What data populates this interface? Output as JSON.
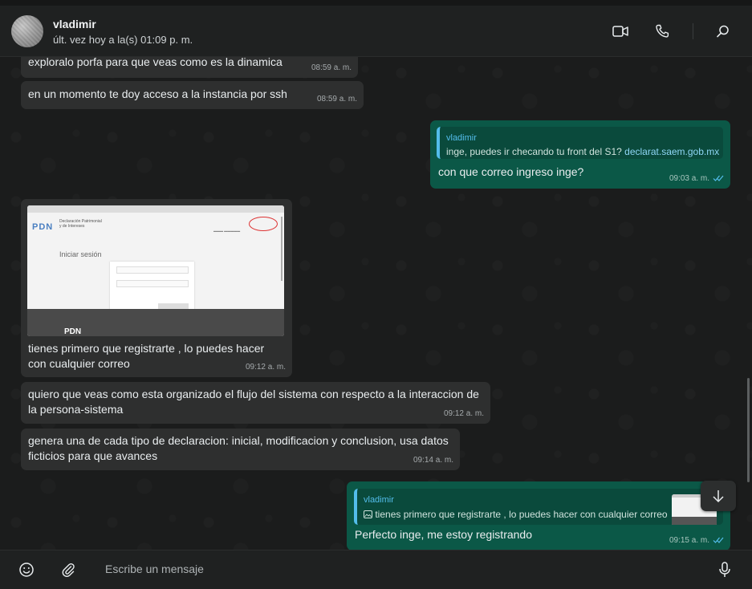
{
  "header": {
    "contact_name": "vladimir",
    "last_seen": "últ. vez hoy a la(s) 01:09 p. m."
  },
  "icons": {
    "video": "video-call-icon",
    "call": "phone-icon",
    "search": "search-icon",
    "emoji": "emoji-icon",
    "attach": "paperclip-icon",
    "mic": "microphone-icon",
    "scroll_down": "arrow-down-icon"
  },
  "colors": {
    "incoming_bubble": "#2e2f2f",
    "outgoing_bubble": "#0b5847",
    "quote_accent": "#53bdeb",
    "read_ticks": "#53bdeb"
  },
  "messages": [
    {
      "direction": "in",
      "text": "exploralo porfa para que veas como es la dinamica",
      "time": "08:59 a. m."
    },
    {
      "direction": "in",
      "text": "en un momento te doy acceso a la instancia por ssh",
      "time": "08:59 a. m."
    },
    {
      "direction": "out",
      "quote_author": "vladimir",
      "quote_text": "inge, puedes ir checando tu front del S1?",
      "quote_link": "declarat.saem.gob.mx",
      "text": "con que correo ingreso inge?",
      "time": "09:03 a. m."
    },
    {
      "direction": "in",
      "image": {
        "logo": "PDN",
        "subtitle_line1": "Declaración Patrimonial",
        "subtitle_line2": "y de Intereses",
        "heading": "Iniciar sesión",
        "footer_logo": "PDN"
      },
      "line1": "tienes primero que registrarte , lo puedes hacer",
      "line2": "con cualquier correo",
      "time": "09:12 a. m."
    },
    {
      "direction": "in",
      "line1": "quiero que veas como esta organizado el flujo del sistema con respecto a la interaccion de",
      "line2": "la persona-sistema",
      "time": "09:12 a. m."
    },
    {
      "direction": "in",
      "line1": "genera una de cada tipo de declaracion: inicial, modificacion y conclusion, usa datos",
      "line2": "ficticios para que avances",
      "time": "09:14 a. m."
    },
    {
      "direction": "out",
      "quote_author": "vladimir",
      "quote_text": "tienes primero que registrarte , lo puedes hacer con cualquier correo",
      "text": "Perfecto inge, me estoy registrando",
      "time": "09:15 a. m."
    }
  ],
  "composer": {
    "placeholder": "Escribe un mensaje"
  }
}
